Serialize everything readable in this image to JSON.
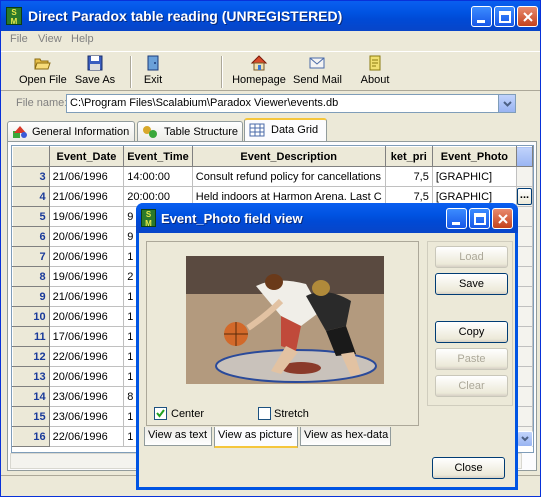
{
  "window": {
    "title": "Direct Paradox table reading (UNREGISTERED)",
    "app_icon": "sm-app-icon"
  },
  "menu": [
    "File",
    "View",
    "Help"
  ],
  "toolbar": {
    "open": "Open File",
    "save_as": "Save As",
    "exit": "Exit",
    "homepage": "Homepage",
    "send_mail": "Send Mail",
    "about": "About"
  },
  "file": {
    "label": "File name:",
    "value": "C:\\Program Files\\Scalabium\\Paradox Viewer\\events.db"
  },
  "tabs": [
    "General Information",
    "Table Structure",
    "Data Grid"
  ],
  "grid": {
    "columns": [
      "Event_Date",
      "Event_Time",
      "Event_Description",
      "ket_pri",
      "Event_Photo"
    ],
    "rows": [
      [
        "3",
        "21/06/1996",
        "14:00:00",
        "Consult refund policy for cancellations",
        "7,5",
        "[GRAPHIC]"
      ],
      [
        "4",
        "21/06/1996",
        "20:00:00",
        "Held indoors at Harmon Arena.  Last C",
        "7,5",
        "[GRAPHIC]"
      ],
      [
        "5",
        "19/06/1996",
        "9",
        "",
        "",
        ""
      ],
      [
        "6",
        "20/06/1996",
        "9",
        "",
        "",
        ""
      ],
      [
        "7",
        "20/06/1996",
        "1",
        "",
        "",
        ""
      ],
      [
        "8",
        "19/06/1996",
        "2",
        "",
        "",
        ""
      ],
      [
        "9",
        "21/06/1996",
        "1",
        "",
        "",
        ""
      ],
      [
        "10",
        "20/06/1996",
        "1",
        "",
        "",
        ""
      ],
      [
        "11",
        "17/06/1996",
        "1",
        "",
        "",
        ""
      ],
      [
        "12",
        "22/06/1996",
        "1",
        "",
        "",
        ""
      ],
      [
        "13",
        "20/06/1996",
        "1",
        "",
        "",
        ""
      ],
      [
        "14",
        "23/06/1996",
        "8",
        "",
        "",
        ""
      ],
      [
        "15",
        "23/06/1996",
        "1",
        "",
        "",
        ""
      ],
      [
        "16",
        "22/06/1996",
        "1",
        "",
        "",
        ""
      ]
    ]
  },
  "dialog": {
    "title": "Event_Photo field view",
    "buttons": {
      "load": "Load",
      "save": "Save",
      "copy": "Copy",
      "paste": "Paste",
      "clear": "Clear",
      "close": "Close"
    },
    "center_label": "Center",
    "center_checked": true,
    "stretch_label": "Stretch",
    "stretch_checked": false,
    "view_tabs": [
      "View as text",
      "View as picture",
      "View as hex-data"
    ],
    "active_view": "View as picture"
  },
  "colors": {
    "titlebar": "#0054e3",
    "rownum": "#1a3a9a",
    "tab_highlight": "#f5c63c"
  }
}
